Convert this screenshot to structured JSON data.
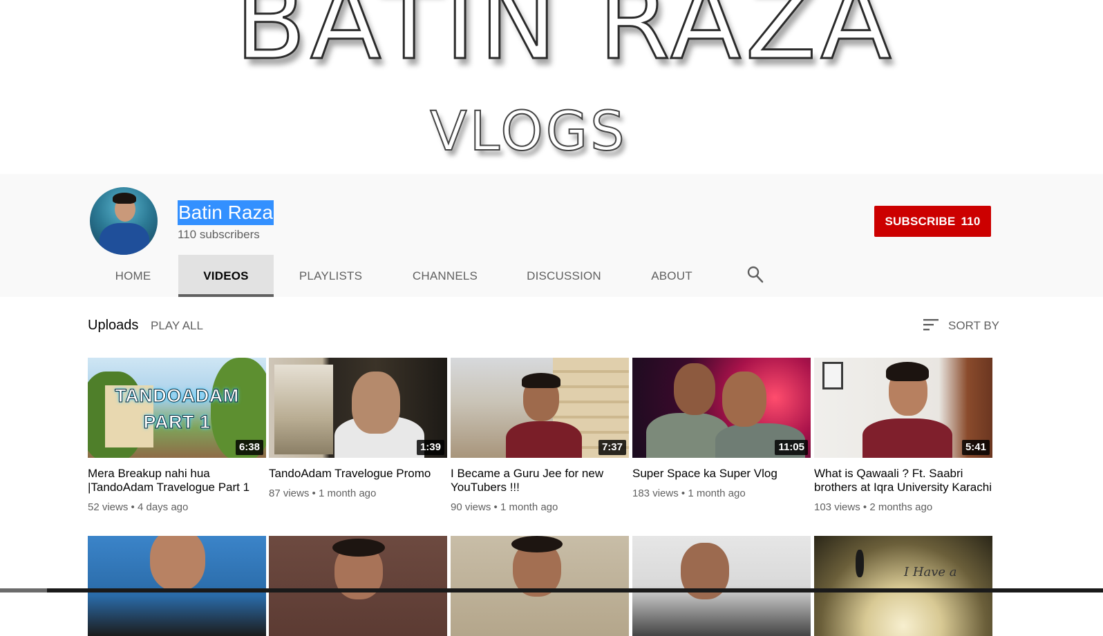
{
  "banner": {
    "title": "BATIN RAZA",
    "subtitle": "VLOGS"
  },
  "channel": {
    "name": "Batin Raza",
    "subscribers": "110 subscribers",
    "subscribe_label": "SUBSCRIBE",
    "subscribe_count": "110",
    "subscribe_color": "#cc0000",
    "selection_highlight_color": "#3390ff"
  },
  "tabs": [
    {
      "label": "HOME",
      "active": false
    },
    {
      "label": "VIDEOS",
      "active": true
    },
    {
      "label": "PLAYLISTS",
      "active": false
    },
    {
      "label": "CHANNELS",
      "active": false
    },
    {
      "label": "DISCUSSION",
      "active": false
    },
    {
      "label": "ABOUT",
      "active": false
    }
  ],
  "tab_search_icon": "search-icon",
  "uploads": {
    "title": "Uploads",
    "play_all": "PLAY ALL",
    "sort_by": "SORT BY",
    "sort_icon": "sort-icon"
  },
  "videos": [
    {
      "duration": "6:38",
      "title": "Mera Breakup nahi hua |TandoAdam Travelogue Part 1",
      "views": "52 views",
      "age": "4 days ago",
      "thumb_text_line1": "TANDOADAM",
      "thumb_text_line2": "PART 1"
    },
    {
      "duration": "1:39",
      "title": "TandoAdam Travelogue Promo",
      "views": "87 views",
      "age": "1 month ago"
    },
    {
      "duration": "7:37",
      "title": "I Became a Guru Jee for new YouTubers !!!",
      "views": "90 views",
      "age": "1 month ago"
    },
    {
      "duration": "11:05",
      "title": "Super Space ka Super Vlog",
      "views": "183 views",
      "age": "1 month ago"
    },
    {
      "duration": "5:41",
      "title": "What is Qawaali ? Ft. Saabri brothers at Iqra University Karachi",
      "views": "103 views",
      "age": "2 months ago"
    }
  ],
  "second_row": {
    "thumb5_text": "I Have a"
  },
  "separator": "•"
}
